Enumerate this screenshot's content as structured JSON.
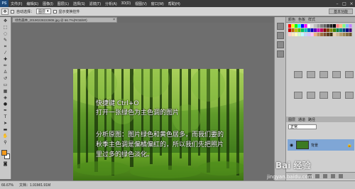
{
  "app": {
    "logo": "PS",
    "menu": [
      "文件(F)",
      "编辑(E)",
      "图像(I)",
      "图层(L)",
      "选择(S)",
      "滤镜(T)",
      "分析(A)",
      "3D(D)",
      "视图(V)",
      "窗口(W)",
      "帮助(H)"
    ],
    "workspace": "基本功能"
  },
  "options": {
    "auto_select_label": "自动选择：",
    "auto_select_value": "图层",
    "show_transform_label": "显示变换控件"
  },
  "document": {
    "tab_title": "绿色森林_20190228222808.jpg @ 66.7%(RGB/8#)",
    "zoom": "66.67%",
    "doc_info": "文档：1.91M/1.91M"
  },
  "overlay": {
    "line1": "快捷键 Ctrl+O",
    "line2": "打开一张绿色为主色调的图片",
    "line3": "分析原图：图片绿色和黄色居多，而我们要的",
    "line4": "秋季主色调是偏橘偏红的，所以我们先把照片",
    "line5": "里过多的绿色淡化。"
  },
  "panels": {
    "tabs_top": [
      "颜色",
      "色板",
      "样式"
    ],
    "tabs_layers": [
      "图层",
      "通道",
      "路径"
    ],
    "blend_mode": "正常",
    "layer_name": "背景"
  },
  "watermark": {
    "brand": "Bai 经验",
    "url": "jingyan.baidu.com"
  },
  "colors": {
    "foreground": "#f39a1c",
    "background": "#ffffff"
  }
}
